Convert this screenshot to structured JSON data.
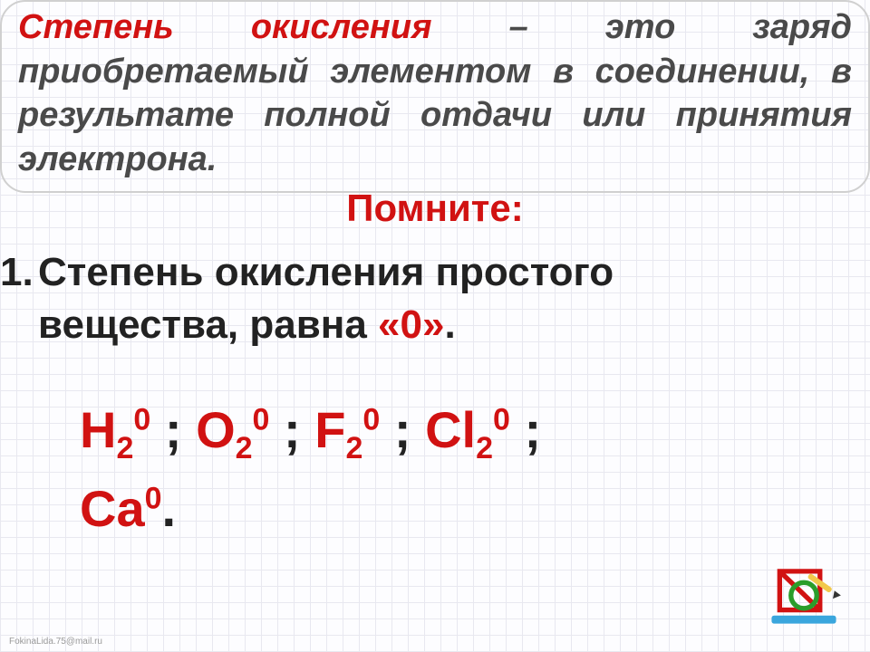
{
  "definition": {
    "term": "Степень окисления",
    "rest": " – это заряд приобретаемый элементом в соединении, в результате полной отдачи или принятия электрона."
  },
  "remember_label": "Помните:",
  "rule1": {
    "number": "1.",
    "text_a": "Степень окисления простого",
    "text_b": "вещества, равна ",
    "zero": "«0»",
    "period": "."
  },
  "formulas": {
    "items": [
      {
        "sym": "H",
        "sub": "2",
        "sup": "0",
        "after": " ;   "
      },
      {
        "sym": "O",
        "sub": "2",
        "sup": "0",
        "after": " ;   "
      },
      {
        "sym": "F",
        "sub": "2",
        "sup": "0",
        "after": " ;   "
      },
      {
        "sym": "Cl",
        "sub": "2",
        "sup": "0",
        "after": " ;"
      },
      {
        "sym": "Ca",
        "sub": "",
        "sup": "0",
        "after": "."
      }
    ]
  },
  "credit": "FokinaLida.75@mail.ru"
}
